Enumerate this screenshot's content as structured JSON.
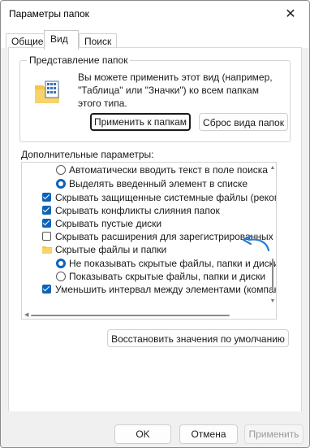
{
  "window": {
    "title": "Параметры папок",
    "close_glyph": "✕"
  },
  "tabs": [
    {
      "label": "Общие",
      "active": false
    },
    {
      "label": "Вид",
      "active": true
    },
    {
      "label": "Поиск",
      "active": false
    }
  ],
  "folder_view": {
    "legend": "Представление папок",
    "description": "Вы можете применить этот вид (например, \"Таблица\" или \"Значки\") ко всем папкам этого типа.",
    "apply_button": "Применить к папкам",
    "reset_button": "Сброс вида папок",
    "icon": "folder-icon"
  },
  "advanced": {
    "label": "Дополнительные параметры:",
    "items": [
      {
        "type": "radio",
        "checked": false,
        "label": "Автоматически вводить текст в поле поиска"
      },
      {
        "type": "radio",
        "checked": true,
        "label": "Выделять введенный элемент в списке"
      },
      {
        "type": "checkbox",
        "checked": true,
        "label": "Скрывать защищенные системные файлы (рекомен"
      },
      {
        "type": "checkbox",
        "checked": true,
        "label": "Скрывать конфликты слияния папок"
      },
      {
        "type": "checkbox",
        "checked": true,
        "label": "Скрывать пустые диски"
      },
      {
        "type": "checkbox",
        "checked": false,
        "label": "Скрывать расширения для зарегистрированных типо"
      },
      {
        "type": "folder",
        "label": "Скрытые файлы и папки"
      },
      {
        "type": "radio",
        "checked": true,
        "label": "Не показывать скрытые файлы, папки и диски"
      },
      {
        "type": "radio",
        "checked": false,
        "label": "Показывать скрытые файлы, папки и диски"
      },
      {
        "type": "checkbox",
        "checked": true,
        "label": "Уменьшить интервал между элементами (компактн"
      }
    ],
    "accent_color": "#0f63b6",
    "restore_button": "Восстановить значения по умолчанию"
  },
  "footer": {
    "ok": "OK",
    "cancel": "Отмена",
    "apply": "Применить"
  }
}
